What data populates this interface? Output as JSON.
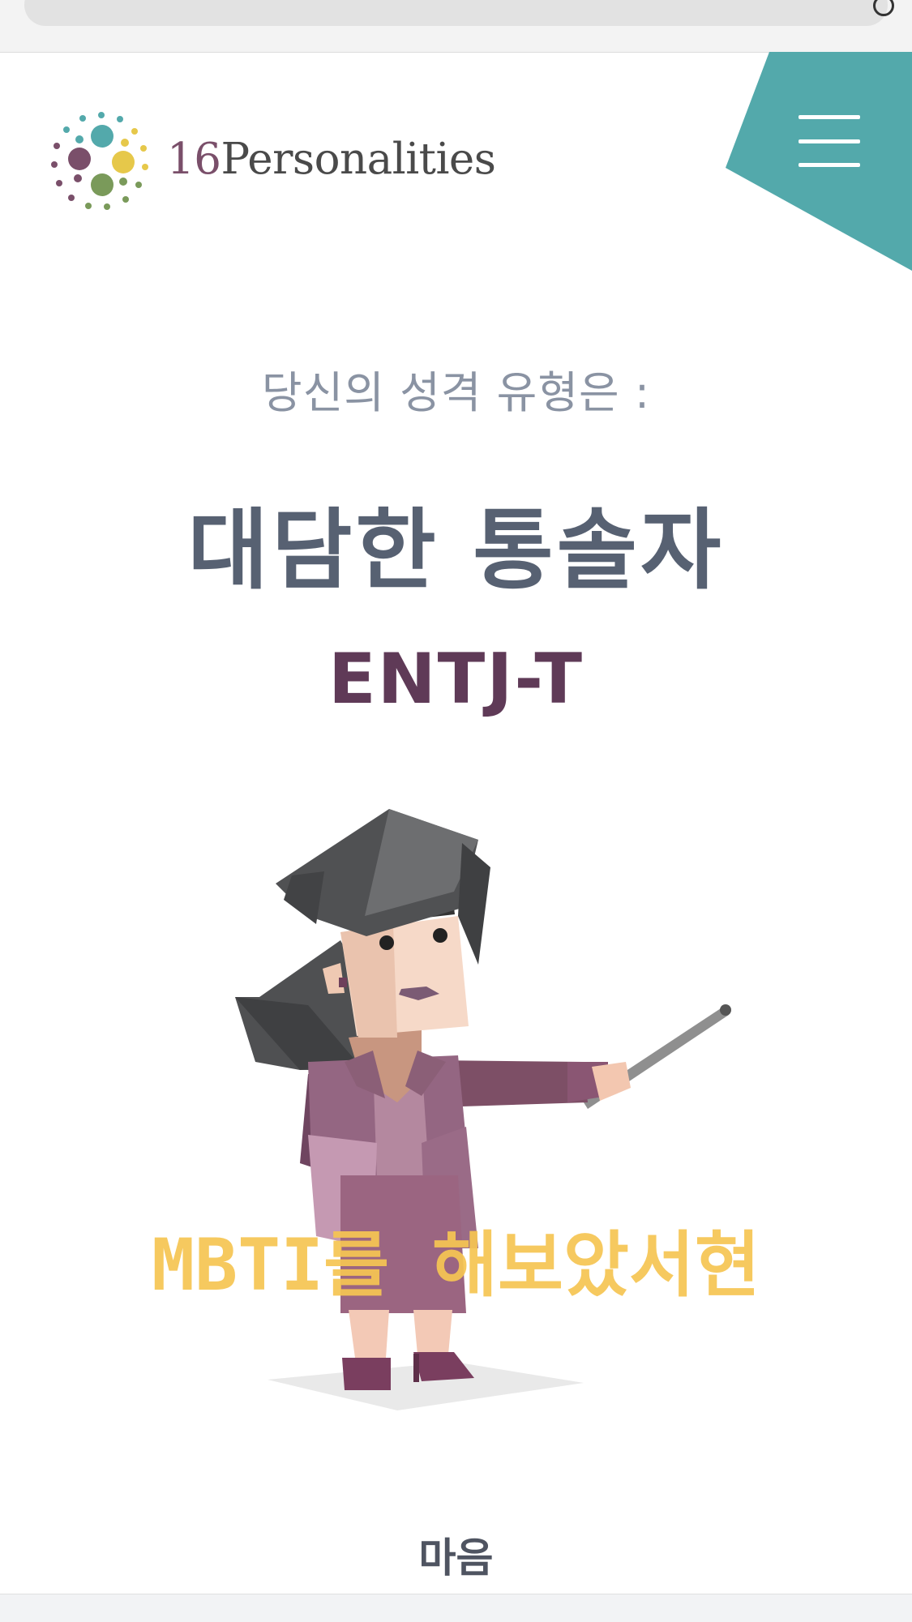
{
  "brand": {
    "logo_number": "16",
    "logo_word": "Personalities"
  },
  "header": {
    "menu_icon": "hamburger-menu-icon",
    "accent_color": "#53a9ab"
  },
  "result": {
    "intro": "당신의 성격 유형은 :",
    "type_name": "대담한 통솔자",
    "type_code": "ENTJ-T"
  },
  "illustration": {
    "icon": "entj-commander-character-illustration"
  },
  "overlay": {
    "caption": "MBTI를 해보았서현"
  },
  "footer": {
    "section_label": "마음"
  },
  "colors": {
    "intro_text": "#8a93a3",
    "type_name_text": "#576172",
    "type_code_text": "#5f3a57",
    "overlay_text": "#f6c553"
  }
}
